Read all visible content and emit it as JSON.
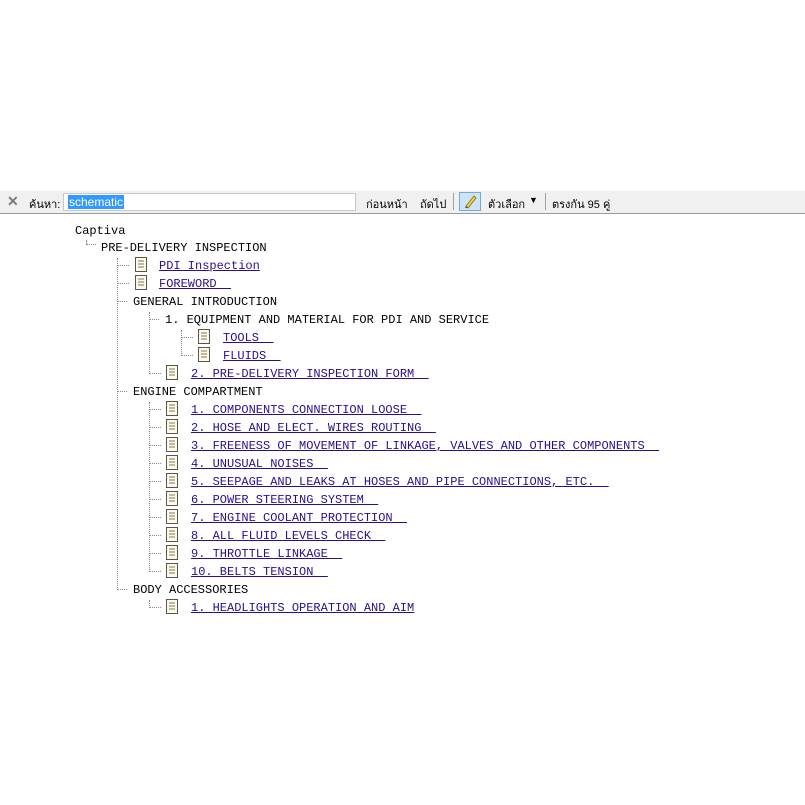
{
  "findbar": {
    "close_symbol": "✕",
    "search_label": "ค้นหา:",
    "search_value": "schematic",
    "prev_label": "ก่อนหน้า",
    "next_label": "ถัดไป",
    "options_label": "ตัวเลือก",
    "options_arrow": "▼",
    "match_count": "ตรงกัน 95 คู่"
  },
  "tree": {
    "root": "Captiva",
    "section1": "PRE-DELIVERY INSPECTION",
    "pdi_inspection": "PDI Inspection",
    "foreword": "FOREWORD  ",
    "general_intro": "GENERAL INTRODUCTION",
    "equipment": "1. EQUIPMENT AND MATERIAL FOR PDI AND SERVICE",
    "tools": "TOOLS  ",
    "fluids": "FLUIDS  ",
    "pdi_form": "2. PRE-DELIVERY INSPECTION FORM  ",
    "engine_compartment": "ENGINE COMPARTMENT",
    "engine_items": [
      "1. COMPONENTS CONNECTION LOOSE  ",
      "2. HOSE AND ELECT. WIRES ROUTING  ",
      "3. FREENESS OF MOVEMENT OF LINKAGE, VALVES AND OTHER COMPONENTS  ",
      "4. UNUSUAL NOISES  ",
      "5. SEEPAGE AND LEAKS AT HOSES AND PIPE CONNECTIONS, ETC.  ",
      "6. POWER STEERING SYSTEM  ",
      "7. ENGINE COOLANT PROTECTION  ",
      "8. ALL FLUID LEVELS CHECK  ",
      "9. THROTTLE LINKAGE  ",
      "10. BELTS TENSION  "
    ],
    "body_accessories": "BODY ACCESSORIES",
    "body_items": [
      "1. HEADLIGHTS OPERATION AND AIM"
    ]
  }
}
